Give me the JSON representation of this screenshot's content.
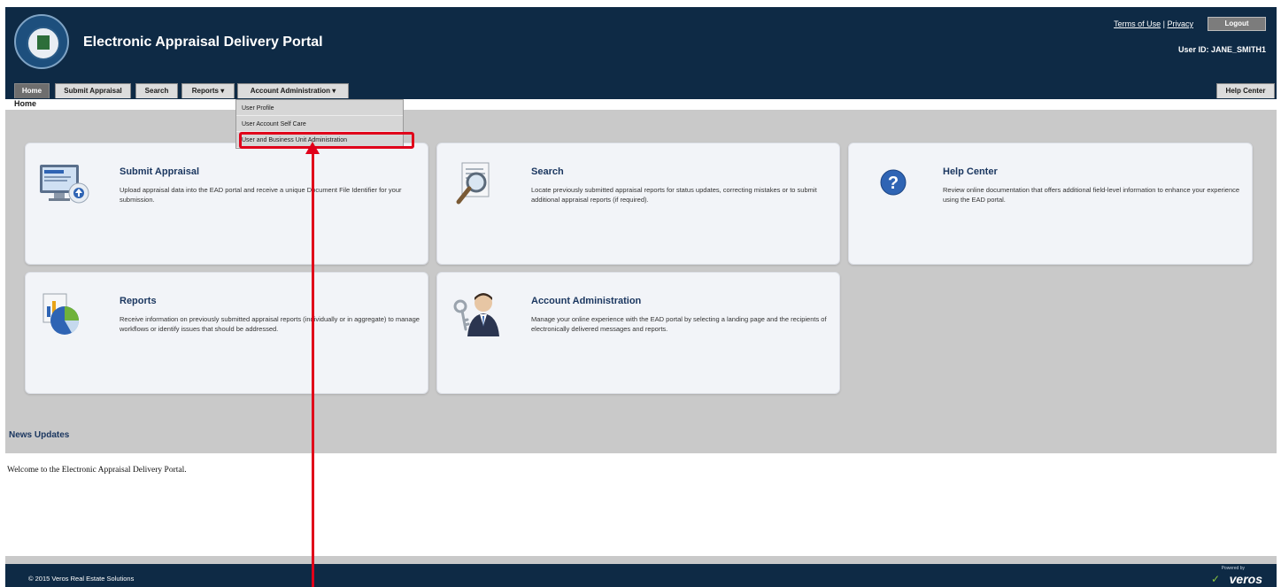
{
  "header": {
    "title": "Electronic Appraisal Delivery Portal",
    "links": {
      "terms": "Terms of Use",
      "separator": "|",
      "privacy": "Privacy"
    },
    "logout": "Logout",
    "user_id": "User ID: JANE_SMITH1"
  },
  "nav": {
    "tabs": [
      {
        "label": "Home",
        "active": true
      },
      {
        "label": "Submit Appraisal"
      },
      {
        "label": "Search"
      },
      {
        "label": "Reports ▾"
      },
      {
        "label": "Account Administration ▾"
      }
    ],
    "help": "Help Center"
  },
  "breadcrumb": "Home",
  "dropdown": {
    "items": [
      "User Profile",
      "User Account Self Care",
      "User and Business Unit Administration"
    ]
  },
  "cards": [
    {
      "title": "Submit Appraisal",
      "desc": "Upload appraisal data into the EAD portal and receive a unique Document File Identifier for your submission.",
      "icon": "monitor-upload-icon"
    },
    {
      "title": "Search",
      "desc": "Locate previously submitted appraisal reports for status updates, correcting mistakes or to submit additional appraisal reports (if required).",
      "icon": "magnifier-document-icon"
    },
    {
      "title": "Help Center",
      "desc": "Review online documentation that offers additional field-level information to enhance your experience using the EAD portal.",
      "icon": "question-mark-icon"
    },
    {
      "title": "Reports",
      "desc": "Receive information on previously submitted appraisal reports (individually or in aggregate) to manage workflows or identify issues that should be addressed.",
      "icon": "pie-chart-report-icon"
    },
    {
      "title": "Account Administration",
      "desc": "Manage your online experience with the EAD portal by selecting a landing page and the recipients of electronically delivered messages and reports.",
      "icon": "user-key-icon"
    }
  ],
  "news": {
    "title": "News Updates",
    "text": "Welcome to the Electronic Appraisal Delivery Portal."
  },
  "footer": {
    "copyright": "© 2015 Veros Real Estate Solutions",
    "powered_by": "Powered by",
    "logo": "veros"
  },
  "colors": {
    "header_bg": "#0e2a45",
    "title_blue": "#1b3760",
    "annotation_red": "#e0001a",
    "help_icon_blue": "#2f64b4"
  }
}
